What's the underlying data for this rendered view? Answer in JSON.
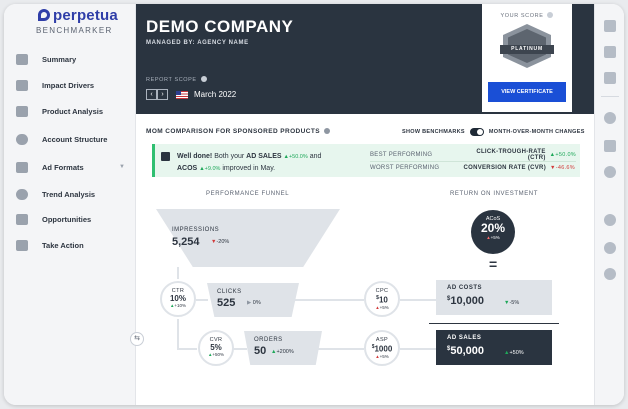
{
  "brand": {
    "name": "perpetua",
    "product": "BENCHMARKER"
  },
  "sidebar": {
    "items": [
      {
        "label": "Summary",
        "icon": "summary-icon"
      },
      {
        "label": "Impact Drivers",
        "icon": "impact-drivers-icon"
      },
      {
        "label": "Product Analysis",
        "icon": "product-analysis-icon"
      },
      {
        "label": "Account Structure",
        "icon": "account-structure-icon"
      },
      {
        "label": "Ad Formats",
        "icon": "ad-formats-icon"
      },
      {
        "label": "Trend Analysis",
        "icon": "trend-analysis-icon"
      },
      {
        "label": "Opportunities",
        "icon": "opportunities-icon"
      },
      {
        "label": "Take Action",
        "icon": "take-action-icon"
      }
    ]
  },
  "header": {
    "company": "DEMO COMPANY",
    "managed_by": "MANAGED BY: AGENCY NAME",
    "report_scope_label": "REPORT SCOPE",
    "month": "March 2022",
    "prev_symbol": "‹",
    "next_symbol": "›"
  },
  "score": {
    "title": "YOUR SCORE",
    "badge_text": "PLATINUM",
    "cta": "VIEW CERTIFICATE",
    "accent": "#1a4fd6"
  },
  "mom": {
    "title": "MOM COMPARISON FOR SPONSORED PRODUCTS",
    "show_benchmarks": "SHOW BENCHMARKS",
    "mom_changes": "MONTH-OVER-MONTH CHANGES",
    "message_lead": "Well done!",
    "message_mid": "Both your",
    "metric_1": "AD SALES",
    "metric_1_delta": "+50.0%",
    "message_and": "and",
    "metric_2": "ACOS",
    "metric_2_delta": "+9.0%",
    "message_tail": "improved in May.",
    "best_label": "BEST PERFORMING",
    "best_value": "CLICK-TROUGH-RATE (CTR)",
    "best_delta": "+50.0%",
    "worst_label": "WORST PERFORMING",
    "worst_value": "CONVERSION RATE (CVR)",
    "worst_delta": "-46.6%"
  },
  "funnel": {
    "title": "PERFORMANCE FUNNEL",
    "impressions": {
      "label": "IMPRESSIONS",
      "value": "5,254",
      "delta": "-20%"
    },
    "ctr": {
      "label": "CTR",
      "value": "10%",
      "delta": "+10%"
    },
    "clicks": {
      "label": "CLICKS",
      "value": "525",
      "delta": "0%"
    },
    "cvr": {
      "label": "CVR",
      "value": "5%",
      "delta": "+50%"
    },
    "orders": {
      "label": "ORDERS",
      "value": "50",
      "delta": "+200%"
    },
    "cpc": {
      "label": "CPC",
      "currency": "$",
      "value": "10",
      "delta": "+5%"
    },
    "asp": {
      "label": "ASP",
      "currency": "$",
      "value": "1000",
      "delta": "+5%"
    }
  },
  "roi": {
    "title": "RETURN ON INVESTMENT",
    "acos": {
      "label": "ACoS",
      "value": "20%",
      "delta": "+5%"
    },
    "equals": "=",
    "ad_costs": {
      "label": "AD COSTS",
      "currency": "$",
      "value": "10,000",
      "delta": "-5%"
    },
    "ad_sales": {
      "label": "AD SALES",
      "currency": "$",
      "value": "50,000",
      "delta": "+50%"
    }
  },
  "glyphs": {
    "up": "▲",
    "down": "▼",
    "info": "?",
    "collapse": "⇆",
    "caret": "▼"
  },
  "colors": {
    "header_bg": "#2a3440",
    "positive": "#1fa85a",
    "negative": "#d23b3b",
    "highlight_bg": "#e7f6ee"
  }
}
